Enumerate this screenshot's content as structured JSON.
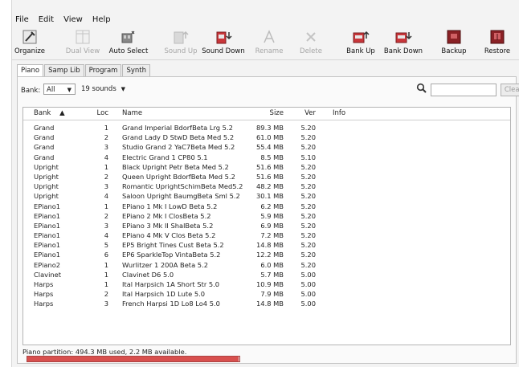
{
  "menu": [
    "File",
    "Edit",
    "View",
    "Help"
  ],
  "toolbar": [
    {
      "label": "Organize",
      "icon": "organize-icon",
      "enabled": true
    },
    {
      "label": "Dual View",
      "icon": "dual-view-icon",
      "enabled": false
    },
    {
      "label": "Auto Select",
      "icon": "auto-select-icon",
      "enabled": true
    },
    {
      "label": "Sound Up",
      "icon": "sound-up-icon",
      "enabled": false
    },
    {
      "label": "Sound Down",
      "icon": "sound-down-icon",
      "enabled": true
    },
    {
      "label": "Rename",
      "icon": "rename-icon",
      "enabled": false
    },
    {
      "label": "Delete",
      "icon": "delete-icon",
      "enabled": false
    },
    {
      "label": "Bank Up",
      "icon": "bank-up-icon",
      "enabled": true
    },
    {
      "label": "Bank Down",
      "icon": "bank-down-icon",
      "enabled": true
    },
    {
      "label": "Backup",
      "icon": "backup-icon",
      "enabled": true
    },
    {
      "label": "Restore",
      "icon": "restore-icon",
      "enabled": true
    }
  ],
  "tabs": [
    "Piano",
    "Samp Lib",
    "Program",
    "Synth"
  ],
  "active_tab": "Piano",
  "filter": {
    "bank_label": "Bank:",
    "bank_value": "All",
    "count_value": "19 sounds",
    "search_placeholder": "",
    "clear_label": "Clear"
  },
  "columns": {
    "bank": "Bank",
    "loc": "Loc",
    "name": "Name",
    "size": "Size",
    "ver": "Ver",
    "info": "Info"
  },
  "rows": [
    {
      "bank": "Grand",
      "loc": "1",
      "name": "Grand Imperial BdorfBeta Lrg 5.2",
      "size": "89.3 MB",
      "ver": "5.20"
    },
    {
      "bank": "Grand",
      "loc": "2",
      "name": "Grand Lady D  StwD Beta Med 5.2",
      "size": "61.0 MB",
      "ver": "5.20"
    },
    {
      "bank": "Grand",
      "loc": "3",
      "name": "Studio Grand 2 YaC7Beta Med 5.2",
      "size": "55.4 MB",
      "ver": "5.20"
    },
    {
      "bank": "Grand",
      "loc": "4",
      "name": "Electric Grand 1 CP80   5.1",
      "size": "8.5 MB",
      "ver": "5.10"
    },
    {
      "bank": "Upright",
      "loc": "1",
      "name": "Black Upright Petr Beta Med 5.2",
      "size": "51.6 MB",
      "ver": "5.20"
    },
    {
      "bank": "Upright",
      "loc": "2",
      "name": "Queen Upright BdorfBeta Med 5.2",
      "size": "51.6 MB",
      "ver": "5.20"
    },
    {
      "bank": "Upright",
      "loc": "3",
      "name": "Romantic UprightSchimBeta Med5.2",
      "size": "48.2 MB",
      "ver": "5.20"
    },
    {
      "bank": "Upright",
      "loc": "4",
      "name": "Saloon Upright BaumgBeta Sml 5.2",
      "size": "30.1 MB",
      "ver": "5.20"
    },
    {
      "bank": "EPiano1",
      "loc": "1",
      "name": "EPiano 1  Mk I LowD Beta 5.2",
      "size": "6.2 MB",
      "ver": "5.20"
    },
    {
      "bank": "EPiano1",
      "loc": "2",
      "name": "EPiano 2  Mk I ClosBeta 5.2",
      "size": "5.9 MB",
      "ver": "5.20"
    },
    {
      "bank": "EPiano1",
      "loc": "3",
      "name": "EPiano 3  Mk II ShalBeta 5.2",
      "size": "6.9 MB",
      "ver": "5.20"
    },
    {
      "bank": "EPiano1",
      "loc": "4",
      "name": "EPiano 4  Mk V Clos Beta 5.2",
      "size": "7.2 MB",
      "ver": "5.20"
    },
    {
      "bank": "EPiano1",
      "loc": "5",
      "name": "EP5 Bright Tines Cust Beta 5.2",
      "size": "14.8 MB",
      "ver": "5.20"
    },
    {
      "bank": "EPiano1",
      "loc": "6",
      "name": "EP6 SparkleTop VintaBeta 5.2",
      "size": "12.2 MB",
      "ver": "5.20"
    },
    {
      "bank": "EPiano2",
      "loc": "1",
      "name": "Wurlitzer 1 200A Beta 5.2",
      "size": "6.0 MB",
      "ver": "5.20"
    },
    {
      "bank": "Clavinet",
      "loc": "1",
      "name": "Clavinet D6  5.0",
      "size": "5.7 MB",
      "ver": "5.00"
    },
    {
      "bank": "Harps",
      "loc": "1",
      "name": "Ital Harpsich 1A Short Str 5.0",
      "size": "10.9 MB",
      "ver": "5.00"
    },
    {
      "bank": "Harps",
      "loc": "2",
      "name": "Ital Harpsich 1D Lute 5.0",
      "size": "7.9 MB",
      "ver": "5.00"
    },
    {
      "bank": "Harps",
      "loc": "3",
      "name": "French Harpsi 1D Lo8 Lo4 5.0",
      "size": "14.8 MB",
      "ver": "5.00"
    }
  ],
  "status": "Piano partition: 494.3 MB used, 2.2 MB available.",
  "partition_used_fraction": 0.9956,
  "colors": {
    "accent": "#c8322f",
    "progress_fill": "#d8504e"
  }
}
